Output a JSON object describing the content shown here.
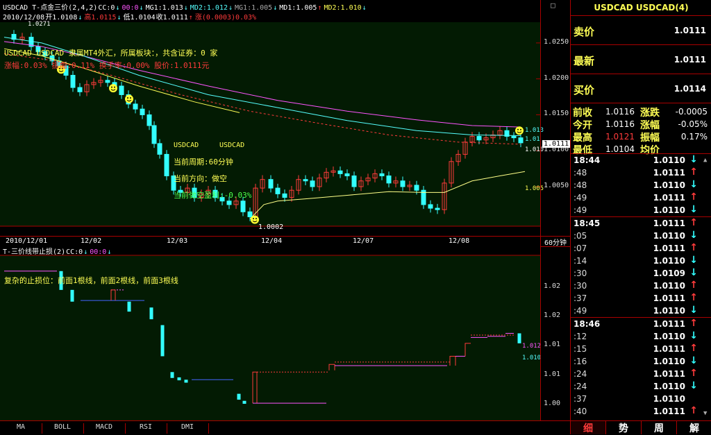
{
  "main_header": {
    "line1": [
      {
        "t": "USDCAD T-点金三价(2,4,2)",
        "c": "wht"
      },
      {
        "t": "CC:0",
        "c": "wht"
      },
      {
        "t": "↓",
        "c": "cyn"
      },
      {
        "t": "00:0",
        "c": "mag"
      },
      {
        "t": "↓",
        "c": "cyn"
      },
      {
        "t": "MG1:1.013",
        "c": "wht"
      },
      {
        "t": "↓",
        "c": "cyn"
      },
      {
        "t": "MD2:1.012",
        "c": "cyn"
      },
      {
        "t": "↓",
        "c": "cyn"
      },
      {
        "t": "MG1:1.005",
        "c": "gry"
      },
      {
        "t": "↓",
        "c": "cyn"
      },
      {
        "t": "MD1:1.005",
        "c": "wht"
      },
      {
        "t": "↑",
        "c": "red"
      },
      {
        "t": "MD2:1.010",
        "c": "yel"
      },
      {
        "t": "↓",
        "c": "cyn"
      }
    ],
    "line2": [
      {
        "t": "2010/12/08",
        "c": "wht"
      },
      {
        "t": "开1.0108",
        "c": "wht"
      },
      {
        "t": "↓",
        "c": "cyn"
      },
      {
        "t": "高1.0115",
        "c": "red"
      },
      {
        "t": "↓",
        "c": "cyn"
      },
      {
        "t": "低1.0104",
        "c": "wht"
      },
      {
        "t": "收1.0111",
        "c": "wht"
      },
      {
        "t": "↑",
        "c": "red"
      },
      {
        "t": "涨(0.0003)0.03%",
        "c": "red"
      }
    ]
  },
  "info_text": {
    "line1": "USDCAD  USDCAD 隶属MT4外汇，所属板块：，共含证券：0 家",
    "line2": "涨幅:0.03% 振幅:0.11% 换手率:0.00% 股价:1.0111元"
  },
  "annotations": {
    "title_a": "USDCAD",
    "title_b": "USDCAD",
    "period": "当前周期:60分钟",
    "direction": "当前方向：做空",
    "profit": "当前做空盈利:-0.03%"
  },
  "price_labels": {
    "high_mark": "1.0271",
    "low_mark": "1.0002",
    "current": "1.0111",
    "ma_a": "1.013",
    "ma_b": "1.01",
    "ma_c": "1.010",
    "ma_d": "1.005"
  },
  "main_axis_ticks": [
    {
      "label": "1.0250",
      "value": 1.025
    },
    {
      "label": "1.0200",
      "value": 1.02
    },
    {
      "label": "1.0150",
      "value": 1.015
    },
    {
      "label": "1.0100",
      "value": 1.01
    },
    {
      "label": "1.0050",
      "value": 1.005
    }
  ],
  "date_labels": [
    "2010/12/01",
    "12/02",
    "12/03",
    "12/04",
    "12/07",
    "12/08"
  ],
  "period_label": "60分钟",
  "sub_header": [
    {
      "t": "T-三价线带止损(2)",
      "c": "wht"
    },
    {
      "t": "CC:0",
      "c": "wht"
    },
    {
      "t": "↓",
      "c": "cyn"
    },
    {
      "t": "00:0",
      "c": "mag"
    },
    {
      "t": "↓",
      "c": "cyn"
    }
  ],
  "sub_text": "复杂的止损位：前面1根线，前面2根线，前面3根线",
  "sub_axis_ticks": [
    {
      "label": "1.02",
      "value": 1.02
    },
    {
      "label": "1.02",
      "value": 1.015
    },
    {
      "label": "1.01",
      "value": 1.01
    },
    {
      "label": "1.01",
      "value": 1.005
    },
    {
      "label": "1.00",
      "value": 1.0
    }
  ],
  "sub_price_labels": {
    "a": "1.012",
    "b": "1.010"
  },
  "quote": {
    "title": "USDCAD USDCAD(4)",
    "sell_label": "卖价",
    "sell_value": "1.0111",
    "last_label": "最新",
    "last_value": "1.0111",
    "buy_label": "买价",
    "buy_value": "1.0114",
    "stats": [
      {
        "l1": "前收",
        "v1": "1.0116",
        "c1": "#fff",
        "l2": "涨跌",
        "v2": "-0.0005",
        "c2": "#fff"
      },
      {
        "l1": "今开",
        "v1": "1.0116",
        "c1": "#fff",
        "l2": "涨幅",
        "v2": "-0.05%",
        "c2": "#fff"
      },
      {
        "l1": "最高",
        "v1": "1.0121",
        "c1": "#ff3b3b",
        "l2": "振幅",
        "v2": "0.17%",
        "c2": "#fff"
      },
      {
        "l1": "最低",
        "v1": "1.0104",
        "c1": "#fff",
        "l2": "均价",
        "v2": "",
        "c2": "#fff"
      }
    ]
  },
  "ticks": [
    {
      "time": "18:44",
      "big": true,
      "price": "1.0110",
      "dir": "down"
    },
    {
      "time": ":48",
      "price": "1.0111",
      "dir": "up"
    },
    {
      "time": ":48",
      "price": "1.0110",
      "dir": "down"
    },
    {
      "time": ":49",
      "price": "1.0111",
      "dir": "up"
    },
    {
      "time": ":49",
      "price": "1.0110",
      "dir": "down"
    },
    {
      "time": "18:45",
      "big": true,
      "price": "1.0111",
      "dir": "up"
    },
    {
      "time": ":05",
      "price": "1.0110",
      "dir": "down"
    },
    {
      "time": ":07",
      "price": "1.0111",
      "dir": "up"
    },
    {
      "time": ":14",
      "price": "1.0110",
      "dir": "down"
    },
    {
      "time": ":30",
      "price": "1.0109",
      "dir": "down"
    },
    {
      "time": ":30",
      "price": "1.0110",
      "dir": "up"
    },
    {
      "time": ":37",
      "price": "1.0111",
      "dir": "up"
    },
    {
      "time": ":49",
      "price": "1.0110",
      "dir": "down"
    },
    {
      "time": "18:46",
      "big": true,
      "price": "1.0111",
      "dir": "up"
    },
    {
      "time": ":12",
      "price": "1.0110",
      "dir": "down"
    },
    {
      "time": ":15",
      "price": "1.0111",
      "dir": "up"
    },
    {
      "time": ":16",
      "price": "1.0110",
      "dir": "down"
    },
    {
      "time": ":24",
      "price": "1.0111",
      "dir": "up"
    },
    {
      "time": ":24",
      "price": "1.0110",
      "dir": "down"
    },
    {
      "time": ":37",
      "price": "1.0110",
      "dir": ""
    },
    {
      "time": ":40",
      "price": "1.0111",
      "dir": "up"
    }
  ],
  "bottom_tabs": [
    "MA",
    "BOLL",
    "MACD",
    "RSI",
    "DMI"
  ],
  "right_tabs": [
    "细",
    "势",
    "周",
    "解"
  ],
  "colors": {
    "up": "#ff3b3b",
    "down": "#33ffff",
    "bg": "#031b03",
    "frame": "#aa0000"
  }
}
